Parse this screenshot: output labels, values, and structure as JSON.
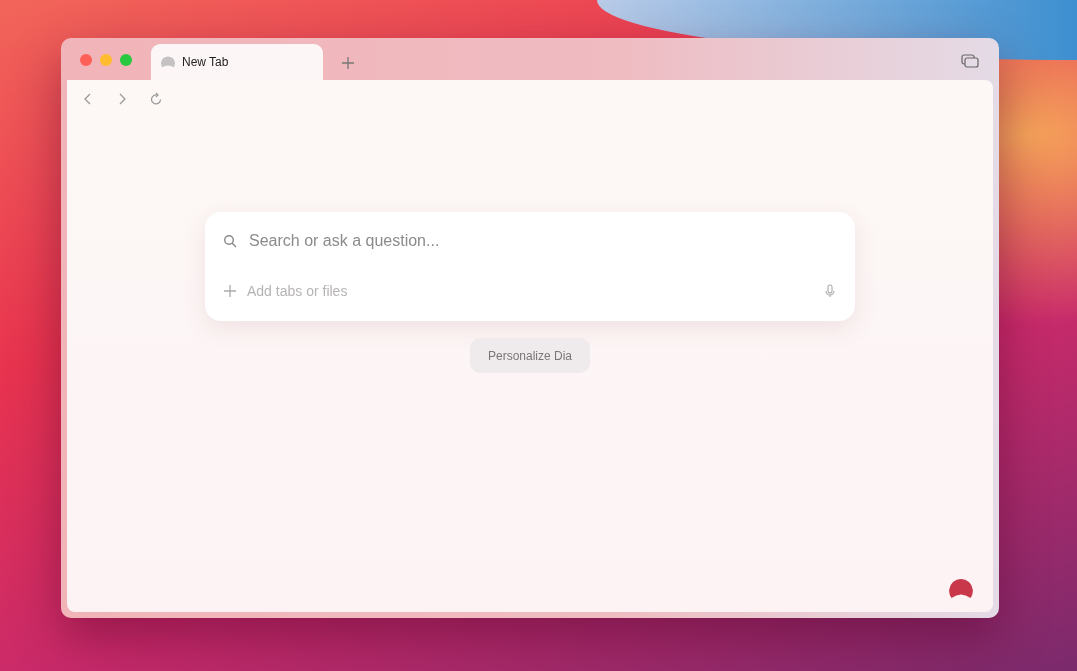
{
  "tabs": [
    {
      "label": "New Tab",
      "selected": true
    }
  ],
  "search": {
    "placeholder": "Search or ask a question..."
  },
  "attach": {
    "placeholder": "Add tabs or files"
  },
  "personalize_button": "Personalize Dia"
}
